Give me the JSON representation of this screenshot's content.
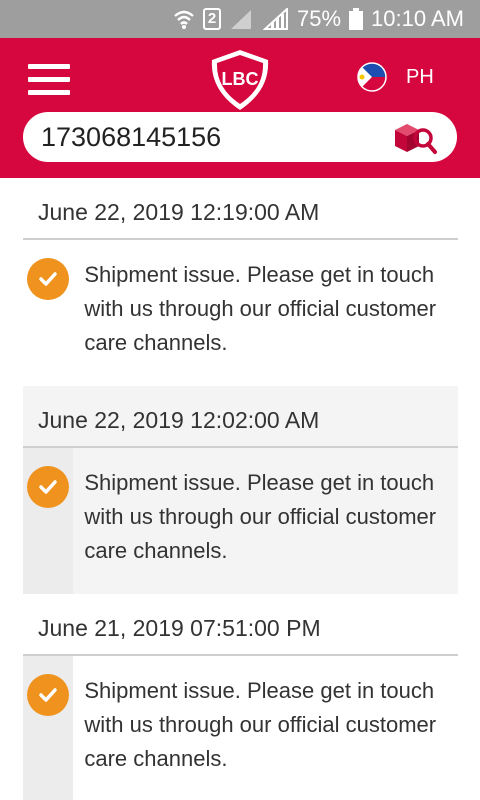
{
  "status_bar": {
    "sim_badge": "2",
    "battery": "75%",
    "time": "10:10 AM"
  },
  "header": {
    "logo_text": "LBC",
    "country": "PH",
    "brand_color": "#d6063f"
  },
  "search": {
    "value": "173068145156"
  },
  "timeline": [
    {
      "date": "June 22, 2019 12:19:00 AM",
      "message": "Shipment issue. Please get in touch with us through our official customer care channels."
    },
    {
      "date": "June 22, 2019 12:02:00 AM",
      "message": "Shipment issue. Please get in touch with us through our official customer care channels."
    },
    {
      "date": "June 21, 2019 07:51:00 PM",
      "message": "Shipment issue. Please get in touch with us through our official customer care channels."
    }
  ],
  "icons": {
    "status_check": "check-circle-icon",
    "search": "package-search-icon",
    "menu": "hamburger-icon"
  }
}
